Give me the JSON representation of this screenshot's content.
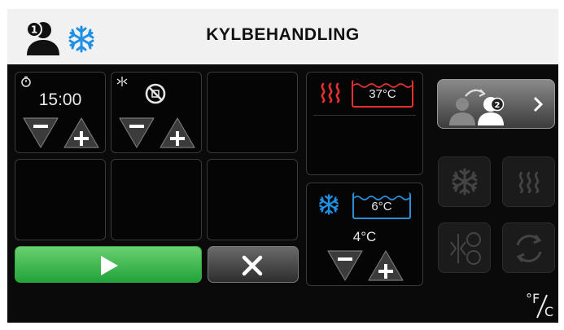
{
  "header": {
    "title": "KYLBEHANDLING",
    "user_badge": "1",
    "icons": [
      "user-1-icon",
      "snowflake-icon"
    ]
  },
  "timer": {
    "icon": "timer-icon",
    "value": "15:00"
  },
  "fan": {
    "icon": "fan-icon",
    "status_icon": "fan-off-icon"
  },
  "stepper": {
    "minus": "−",
    "plus": "+"
  },
  "heat_probe": {
    "icon": "heat-waves-icon",
    "temperature": "37°C"
  },
  "cool_probe": {
    "icon": "snowflake-icon",
    "temperature": "6°C",
    "setpoint": "4°C"
  },
  "switch_user": {
    "badge": "2",
    "icons": [
      "switch-user-icon",
      "chevron-right-icon"
    ]
  },
  "side_buttons": [
    "snowflake-icon",
    "heat-waves-icon",
    "fan-heat-cool-icon",
    "cycle-icon"
  ],
  "units_toggle": {
    "label_f": "°F",
    "label_c": "C"
  },
  "colors": {
    "header_bg": "#f1f1f1",
    "screen_bg": "#0a0a0a",
    "accent_blue": "#1e90e6",
    "heat_red": "#e53030",
    "start_green": "#2fae43"
  }
}
